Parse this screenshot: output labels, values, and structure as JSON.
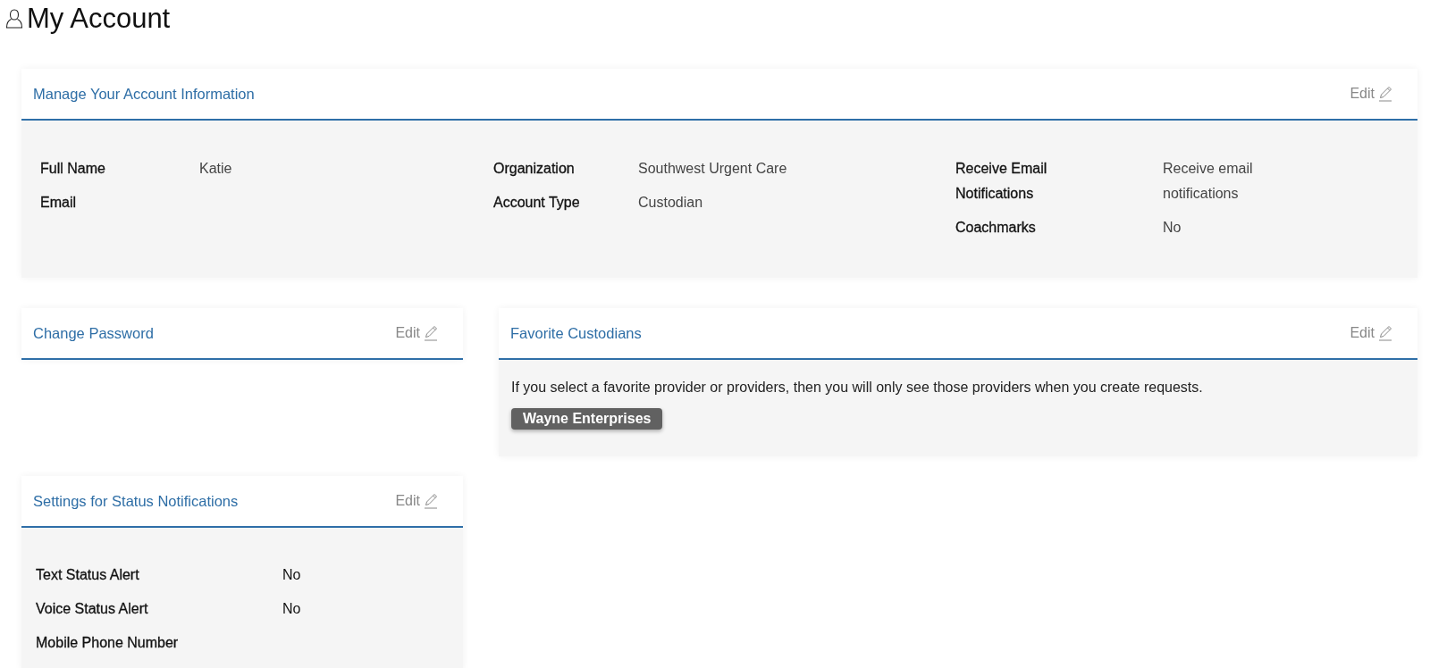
{
  "page_title": "My Account",
  "account_info": {
    "title": "Manage Your Account Information",
    "edit": "Edit",
    "columns": [
      [
        {
          "label": "Full Name",
          "value": "Katie"
        },
        {
          "label": "Email"
        }
      ],
      [
        {
          "label": "Organization",
          "value": "Southwest Urgent Care"
        },
        {
          "label": "Account Type",
          "value": "Custodian"
        }
      ],
      [
        {
          "label": "Receive Email Notifications",
          "value": "Receive email notifications"
        },
        {
          "label": "Coachmarks",
          "value": "No"
        }
      ]
    ]
  },
  "change_password": {
    "title": "Change Password",
    "edit": "Edit"
  },
  "status_notifications": {
    "title": "Settings for Status Notifications",
    "edit": "Edit",
    "fields": [
      {
        "label": "Text Status Alert",
        "value": "No"
      },
      {
        "label": "Voice Status Alert",
        "value": "No"
      },
      {
        "label": "Mobile Phone Number"
      }
    ]
  },
  "favorite_custodians": {
    "title": "Favorite Custodians",
    "edit": "Edit",
    "description": "If you select a favorite provider or providers, then you will only see those providers when you create requests.",
    "tags": [
      "Wayne Enterprises"
    ]
  }
}
